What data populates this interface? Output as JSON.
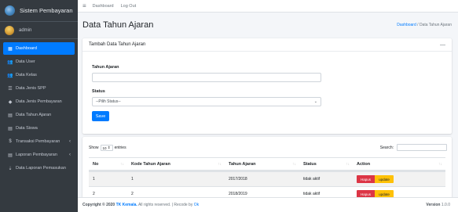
{
  "sidebar": {
    "brand": "Sistem Pembayaran",
    "user": "admin",
    "items": [
      {
        "icon": "▦",
        "label": "Dashboard",
        "active": true
      },
      {
        "icon": "👥",
        "label": "Data User"
      },
      {
        "icon": "👥",
        "label": "Data Kelas"
      },
      {
        "icon": "☰",
        "label": "Data Jenis SPP"
      },
      {
        "icon": "◆",
        "label": "Data Jenis Pembayaran"
      },
      {
        "icon": "▤",
        "label": "Data Tahun Ajaran"
      },
      {
        "icon": "▤",
        "label": "Data Siswa"
      },
      {
        "icon": "$",
        "label": "Transaksi Pembayaran",
        "chevron": "‹"
      },
      {
        "icon": "▤",
        "label": "Laporan Pembayaran",
        "chevron": "‹"
      },
      {
        "icon": "⇣",
        "label": "Data Laporan Pemasukan"
      }
    ]
  },
  "topbar": {
    "links": [
      "Dashboard",
      "Log Out"
    ]
  },
  "header": {
    "title": "Data Tahun Ajaran",
    "breadcrumb_link": "Dashboard",
    "breadcrumb_sep": " / ",
    "breadcrumb_current": "Data Tahun Ajaran"
  },
  "form": {
    "card_title": "Tambah Data Tahun Ajaran",
    "collapse_glyph": "—",
    "tahun_label": "Tahun Ajaran",
    "tahun_value": "",
    "status_label": "Status",
    "status_selected": "--Pilih Status--",
    "save_label": "Save"
  },
  "table": {
    "show_label": "Show",
    "entries_value": "10",
    "entries_label": "entries",
    "search_label": "Search:",
    "columns": [
      "No",
      "Kode Tahun Ajaran",
      "Tahun Ajaran",
      "Status",
      "Action"
    ],
    "rows": [
      {
        "no": "1",
        "kode": "1",
        "tahun": "2017/2018",
        "status": "tidak aktif"
      },
      {
        "no": "2",
        "kode": "2",
        "tahun": "2018/2019",
        "status": "tidak aktif"
      }
    ],
    "hapus_label": "Hapus",
    "update_label": "update"
  },
  "footer": {
    "copyright_prefix": "Copyright © 2020",
    "brand": "TK Kemala.",
    "suffix": "All rights reserved. | Recode by",
    "recoder": "Ok",
    "version_label": "Version",
    "version": "1.0.0"
  },
  "colors": {
    "sidebar_bg": "#343a40",
    "accent": "#007bff",
    "danger": "#dc3545",
    "warning": "#ffc107"
  }
}
